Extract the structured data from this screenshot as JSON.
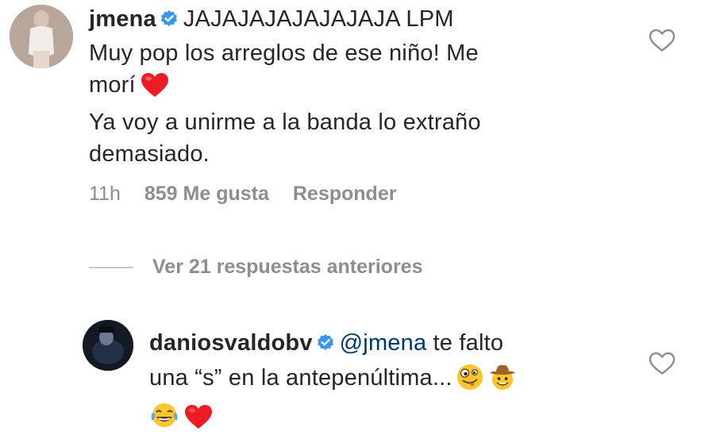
{
  "comment_1": {
    "username": "jmena",
    "text_line_1": "JAJAJAJAJAJAJAJA LPM",
    "text_line_2": "Muy pop los arreglos de ese niño! Me",
    "text_line_3": "morí",
    "text_line_4": "Ya voy a unirme a la banda lo extraño",
    "text_line_5": "demasiado.",
    "time": "11h",
    "likes": "859 Me gusta",
    "reply_label": "Responder"
  },
  "replies": {
    "view_label": "Ver 21 respuestas anteriores"
  },
  "comment_2": {
    "username": "daniosvaldobv",
    "mention": "@jmena",
    "text_line_1": "te falto",
    "text_line_2": "una “s” en la antepenúltima..."
  },
  "colors": {
    "text": "#262626",
    "muted": "#8e8e8e",
    "mention": "#00376b",
    "verified": "#3897f0",
    "heart": "#ed1c24"
  },
  "icons": {
    "verified": "verified-badge-icon",
    "like": "heart-outline-icon",
    "heart_emoji": "red-heart-emoji",
    "zany_emoji": "zany-face-emoji",
    "cowboy_emoji": "cowboy-face-emoji",
    "tears_emoji": "tears-of-joy-emoji"
  }
}
